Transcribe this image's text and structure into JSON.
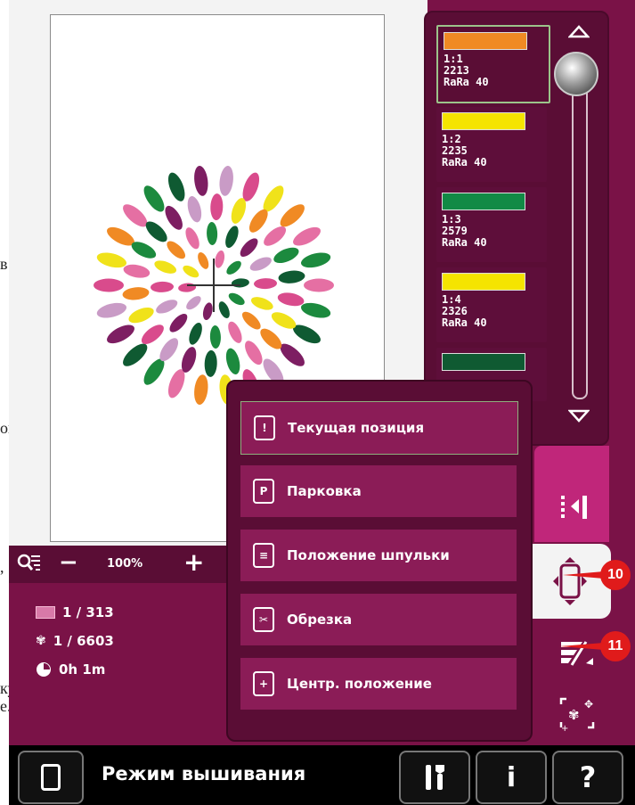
{
  "doc_fragments": [
    "в",
    "ого",
    ",",
    "ку.",
    "е."
  ],
  "hoop": {
    "crosshair": "crosshair-icon"
  },
  "zoom": {
    "level": "100%",
    "minus": "−",
    "plus": "+",
    "icon": "zoom-fit-icon"
  },
  "info": {
    "stitches_label": "1 / 313",
    "colors_label": "1 / 6603",
    "time_label": "0h 1m"
  },
  "colors": [
    {
      "color": "#f08a24",
      "line1": "1:1",
      "line2": "2213",
      "line3": "RaRa 40",
      "selected": true
    },
    {
      "color": "#f5e400",
      "line1": "1:2",
      "line2": "2235",
      "line3": "RaRa 40",
      "selected": false
    },
    {
      "color": "#118a45",
      "line1": "1:3",
      "line2": "2579",
      "line3": "RaRa 40",
      "selected": false
    },
    {
      "color": "#f5e400",
      "line1": "1:4",
      "line2": "2326",
      "line3": "RaRa 40",
      "selected": false
    },
    {
      "color": "#0f5a32",
      "line1": "",
      "line2": "",
      "line3": "",
      "selected": false
    }
  ],
  "menu": {
    "items": [
      {
        "label": "Текущая позиция",
        "icon": "!"
      },
      {
        "label": "Парковка",
        "icon": "P"
      },
      {
        "label": "Положение шпульки",
        "icon": "≡"
      },
      {
        "label": "Обрезка",
        "icon": "✂"
      },
      {
        "label": "Центр. положение",
        "icon": "+"
      }
    ]
  },
  "callouts": {
    "c10": "10",
    "c11": "11"
  },
  "bottom": {
    "title": "Режим вышивания",
    "tools_icon": "tools-icon",
    "info_icon": "i",
    "help_icon": "?"
  },
  "accent": "#7a1247",
  "panel_dark": "#5a0d35"
}
